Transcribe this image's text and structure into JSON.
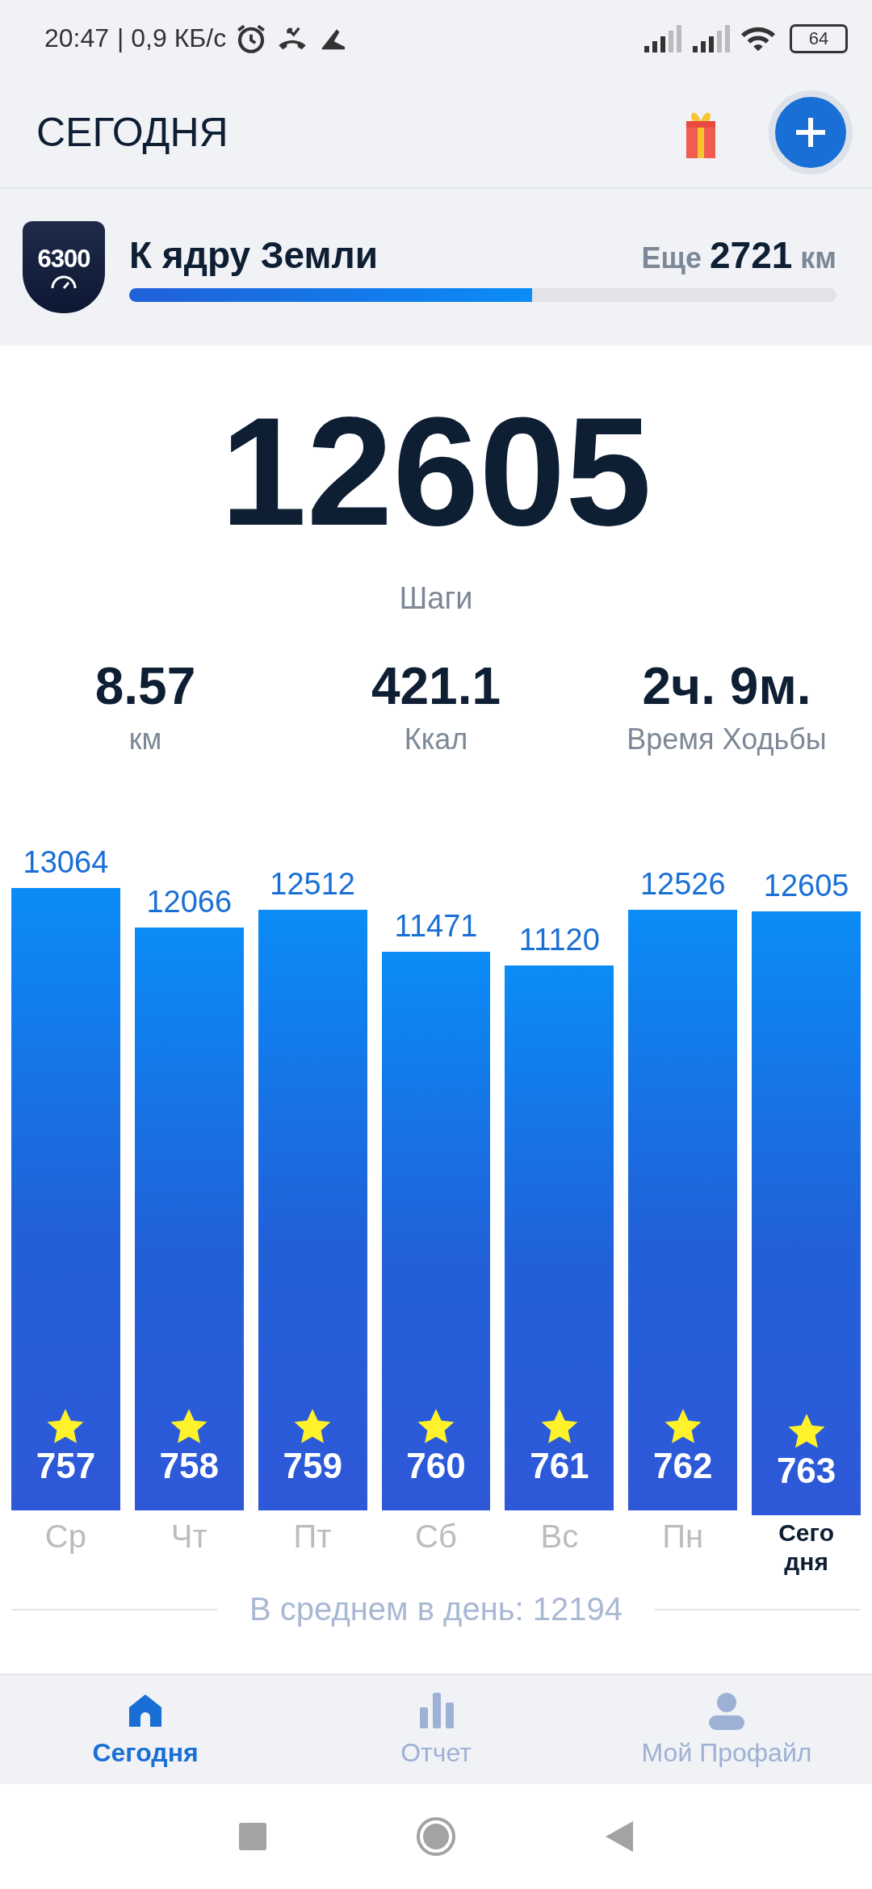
{
  "status_bar": {
    "time": "20:47",
    "speed": "| 0,9 КБ/с",
    "battery": "64"
  },
  "header": {
    "title": "СЕГОДНЯ"
  },
  "challenge": {
    "badge": "6300",
    "title": "К ядру Земли",
    "remaining_prefix": "Еще",
    "remaining": "2721",
    "unit": "км",
    "level": 0.57
  },
  "steps": {
    "value": "12605",
    "label": "Шаги"
  },
  "stats": [
    {
      "value": "8.57",
      "label": "км"
    },
    {
      "value": "421.1",
      "label": "Ккал"
    },
    {
      "value": "2ч. 9м.",
      "label": "Время Ходьбы"
    }
  ],
  "days": [
    {
      "label": "Ср",
      "steps": "13064",
      "number": "757",
      "selected": false
    },
    {
      "label": "Чт",
      "steps": "12066",
      "number": "758",
      "selected": false
    },
    {
      "label": "Пт",
      "steps": "12512",
      "number": "759",
      "selected": false
    },
    {
      "label": "Сб",
      "steps": "11471",
      "number": "760",
      "selected": false
    },
    {
      "label": "Вс",
      "steps": "11120",
      "number": "761",
      "selected": false
    },
    {
      "label": "Пн",
      "steps": "12526",
      "number": "762",
      "selected": false
    },
    {
      "label": "Сегодня",
      "steps": "12605",
      "number": "763",
      "selected": true
    }
  ],
  "average": "В среднем в день: 12194",
  "tabs": [
    {
      "label": "Сегодня",
      "kind": "home",
      "selected": true
    },
    {
      "label": "Отчет",
      "kind": "report",
      "selected": false
    },
    {
      "label": "Мой Профайл",
      "kind": "profile",
      "selected": false
    }
  ]
}
